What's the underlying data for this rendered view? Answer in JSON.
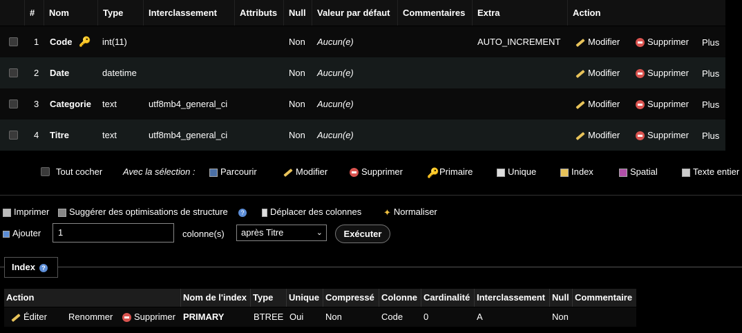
{
  "structure": {
    "headers": [
      "#",
      "Nom",
      "Type",
      "Interclassement",
      "Attributs",
      "Null",
      "Valeur par défaut",
      "Commentaires",
      "Extra",
      "Action"
    ],
    "rows": [
      {
        "num": "1",
        "name": "Code",
        "type": "int(11)",
        "collation": "",
        "attributes": "",
        "null": "Non",
        "default": "Aucun(e)",
        "comments": "",
        "extra": "AUTO_INCREMENT"
      },
      {
        "num": "2",
        "name": "Date",
        "type": "datetime",
        "collation": "",
        "attributes": "",
        "null": "Non",
        "default": "Aucun(e)",
        "comments": "",
        "extra": ""
      },
      {
        "num": "3",
        "name": "Categorie",
        "type": "text",
        "collation": "utf8mb4_general_ci",
        "attributes": "",
        "null": "Non",
        "default": "Aucun(e)",
        "comments": "",
        "extra": ""
      },
      {
        "num": "4",
        "name": "Titre",
        "type": "text",
        "collation": "utf8mb4_general_ci",
        "attributes": "",
        "null": "Non",
        "default": "Aucun(e)",
        "comments": "",
        "extra": ""
      }
    ],
    "actions": {
      "modify": "Modifier",
      "delete": "Supprimer",
      "more": "Plus"
    }
  },
  "selection": {
    "check_all": "Tout cocher",
    "with_selection": "Avec la sélection :",
    "browse": "Parcourir",
    "modify": "Modifier",
    "delete": "Supprimer",
    "primary": "Primaire",
    "unique": "Unique",
    "index": "Index",
    "spatial": "Spatial",
    "fulltext": "Texte entier"
  },
  "tools": {
    "print": "Imprimer",
    "suggest": "Suggérer des optimisations de structure",
    "move": "Déplacer des colonnes",
    "normalize": "Normaliser"
  },
  "add": {
    "label": "Ajouter",
    "count": "1",
    "columns_label": "colonne(s)",
    "position": "après Titre",
    "execute": "Exécuter"
  },
  "index_section": {
    "title": "Index",
    "headers": [
      "Action",
      "Nom de l'index",
      "Type",
      "Unique",
      "Compressé",
      "Colonne",
      "Cardinalité",
      "Interclassement",
      "Null",
      "Commentaire"
    ],
    "actions": {
      "edit": "Éditer",
      "rename": "Renommer",
      "delete": "Supprimer"
    },
    "row": {
      "name": "PRIMARY",
      "type": "BTREE",
      "unique": "Oui",
      "compressed": "Non",
      "column": "Code",
      "cardinality": "0",
      "collation": "A",
      "null": "Non",
      "comment": ""
    }
  },
  "colors": {
    "accent_key": "#f0c040",
    "delete_red": "#d9534f",
    "help_blue": "#5c8dd6"
  }
}
